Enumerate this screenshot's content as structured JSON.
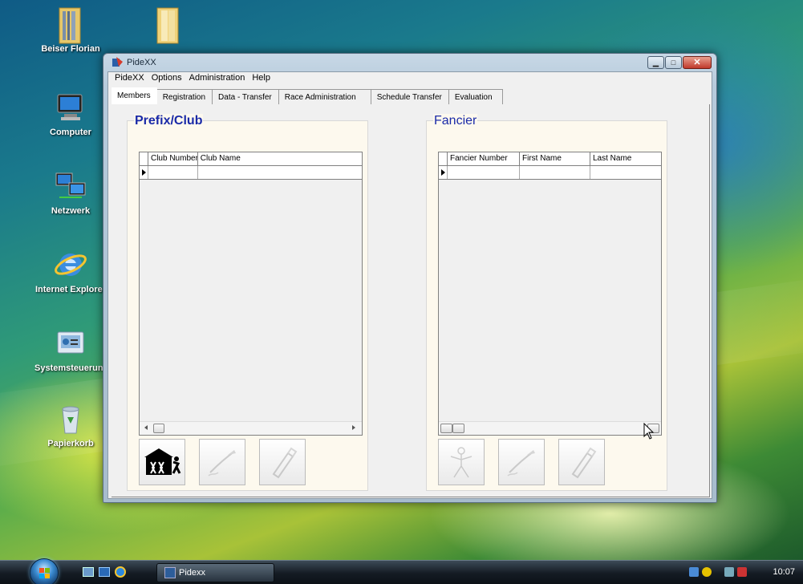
{
  "desktop": {
    "icons": [
      {
        "label": "Beiser Florian",
        "icon": "folder-icon"
      },
      {
        "label": "",
        "icon": "folder-icon"
      },
      {
        "label": "Computer",
        "icon": "computer-icon"
      },
      {
        "label": "Netzwerk",
        "icon": "network-icon"
      },
      {
        "label": "Internet Explorer",
        "icon": "internet-explorer-icon"
      },
      {
        "label": "Systemsteuerung",
        "icon": "control-panel-icon"
      },
      {
        "label": "Papierkorb",
        "icon": "recycle-bin-icon"
      }
    ]
  },
  "window": {
    "title": "PideXX",
    "controls": {
      "minimize": "minimize-icon",
      "maximize": "maximize-icon",
      "close": "close-icon"
    }
  },
  "menu": {
    "items": [
      "PideXX",
      "Options",
      "Administration",
      "Help"
    ]
  },
  "tabs": {
    "items": [
      "Members",
      "Registration",
      "Data - Transfer",
      "Race Administration",
      "Schedule Transfer",
      "Evaluation"
    ],
    "active": "Members"
  },
  "prefix_club": {
    "title": "Prefix/Club",
    "columns": [
      "Club Number",
      "Club Name"
    ],
    "rows": [
      {
        "club_number": "",
        "club_name": ""
      }
    ],
    "buttons": [
      {
        "icon": "club-house-icon",
        "enabled": true
      },
      {
        "icon": "edit-pen-icon",
        "enabled": false
      },
      {
        "icon": "delete-eraser-icon",
        "enabled": false
      }
    ]
  },
  "fancier": {
    "title": "Fancier",
    "columns": [
      "Fancier Number",
      "First Name",
      "Last Name"
    ],
    "rows": [
      {
        "fancier_number": "",
        "first_name": "",
        "last_name": ""
      }
    ],
    "buttons": [
      {
        "icon": "person-icon",
        "enabled": false
      },
      {
        "icon": "edit-pen-icon",
        "enabled": false
      },
      {
        "icon": "delete-eraser-icon",
        "enabled": false
      }
    ]
  },
  "taskbar": {
    "task_label": "Pidexx",
    "clock": "10:07"
  },
  "colors": {
    "group_title": "#1a2aa8",
    "group_background": "#fdf9ee"
  }
}
